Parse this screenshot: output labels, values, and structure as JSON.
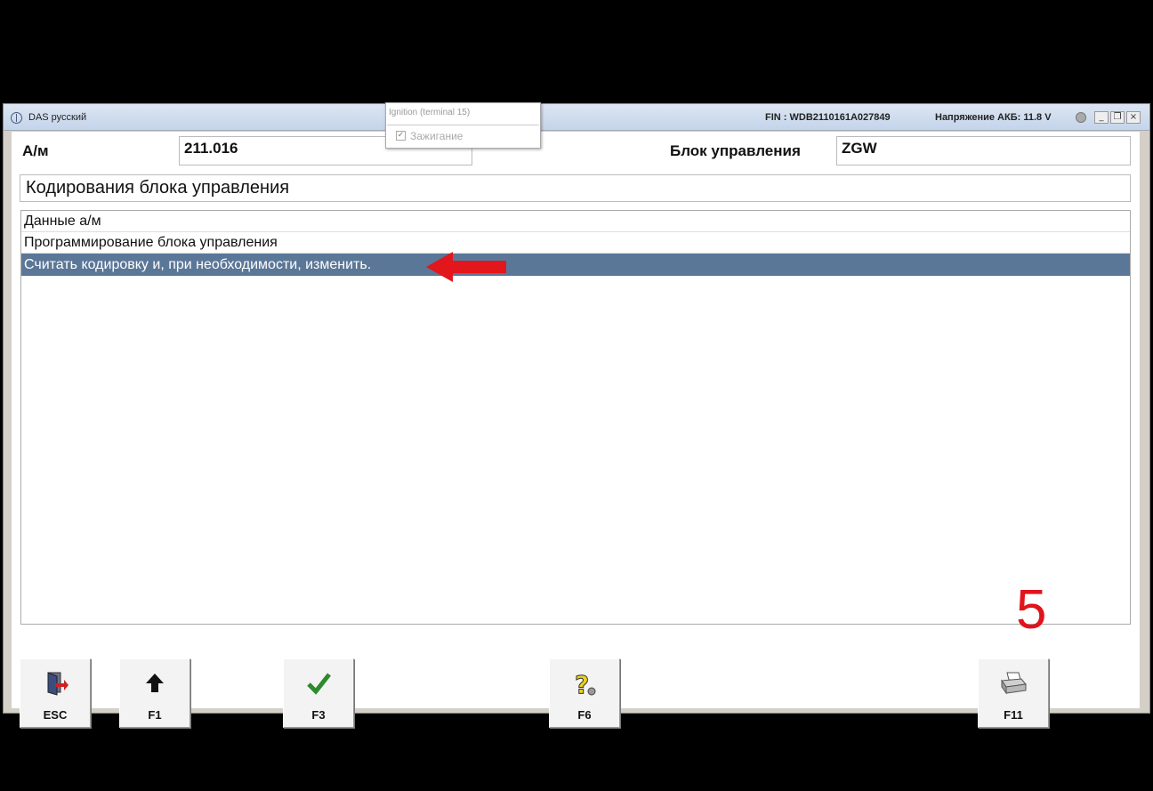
{
  "titlebar": {
    "title": "DAS русский",
    "fin": "FIN : WDB2110161A027849",
    "voltage": "Напряжение АКБ: 11.8 V",
    "minimize": "_",
    "restore": "❐",
    "close": "×"
  },
  "popup": {
    "title": "Ignition (terminal 15)",
    "checkbox_mark": "✓",
    "item_label": "Зажигание"
  },
  "header": {
    "vehicle_label": "А/м",
    "vehicle_value": "211.016",
    "ecu_label": "Блок управления",
    "ecu_value": "ZGW"
  },
  "section_title": "Кодирования блока управления",
  "list": {
    "items": [
      {
        "label": "Данные а/м"
      },
      {
        "label": "Программирование блока управления"
      },
      {
        "label": "Считать кодировку и, при необходимости, изменить."
      }
    ],
    "selected_index": 2
  },
  "annotation": {
    "step_number": "5",
    "arrow_color": "#e3161c"
  },
  "toolbar": {
    "buttons": [
      {
        "key": "ESC",
        "icon": "exit-door-icon"
      },
      {
        "key": "F1",
        "icon": "arrow-up-icon"
      },
      {
        "key": "F3",
        "icon": "checkmark-icon"
      },
      {
        "key": "F6",
        "icon": "help-question-icon"
      },
      {
        "key": "F11",
        "icon": "printer-icon"
      }
    ]
  },
  "colors": {
    "selection": "#5b7798",
    "annotation_red": "#e0141c"
  }
}
